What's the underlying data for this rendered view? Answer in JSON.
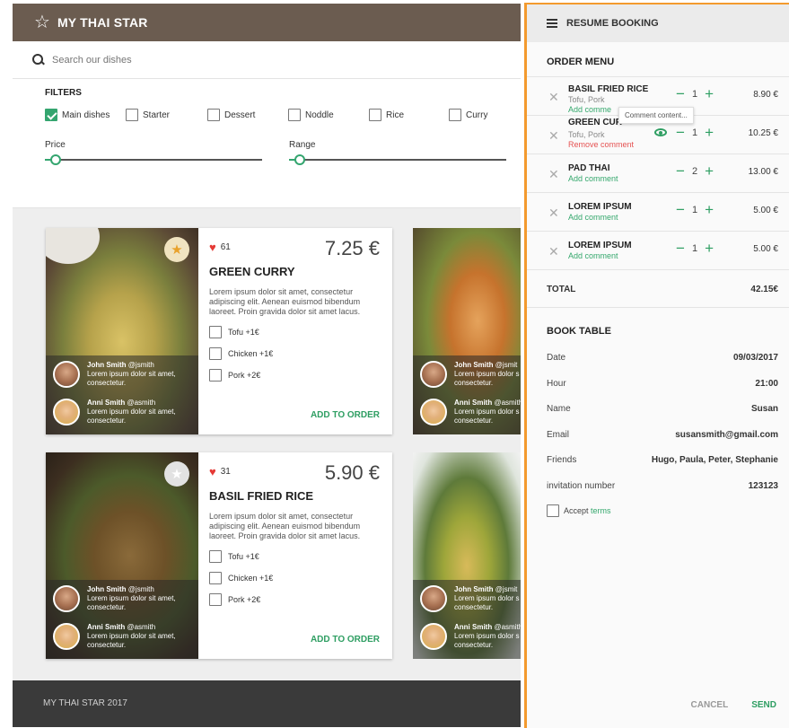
{
  "app": {
    "title": "MY THAI STAR",
    "search_placeholder": "Search our dishes",
    "filters_label": "FILTERS",
    "categories": [
      {
        "label": "Main dishes",
        "checked": true
      },
      {
        "label": "Starter",
        "checked": false
      },
      {
        "label": "Dessert",
        "checked": false
      },
      {
        "label": "Noddle",
        "checked": false
      },
      {
        "label": "Rice",
        "checked": false
      },
      {
        "label": "Curry",
        "checked": false
      }
    ],
    "price_label": "Price",
    "range_label": "Range",
    "footer": "MY THAI STAR 2017"
  },
  "dishes": [
    {
      "name": "GREEN CURRY",
      "likes": "61",
      "price": "7.25 €",
      "favorite": true,
      "description": "Lorem ipsum dolor sit amet, consectetur adipiscing elit. Aenean euismod bibendum laoreet. Proin gravida dolor sit amet lacus.",
      "extras": [
        "Tofu +1€",
        "Chicken +1€",
        "Pork +2€"
      ],
      "add_label": "ADD TO ORDER",
      "reviews": [
        {
          "name": "John Smith",
          "handle": "@jsmith",
          "text": "Lorem ipsum dolor sit amet, consectetur."
        },
        {
          "name": "Anni Smith",
          "handle": "@asmith",
          "text": "Lorem ipsum dolor sit amet, consectetur."
        }
      ]
    },
    {
      "name": "BASIL FRIED RICE",
      "likes": "31",
      "price": "5.90 €",
      "favorite": false,
      "description": "Lorem ipsum dolor sit amet, consectetur adipiscing elit. Aenean euismod bibendum laoreet. Proin gravida dolor sit amet lacus.",
      "extras": [
        "Tofu +1€",
        "Chicken +1€",
        "Pork +2€"
      ],
      "add_label": "ADD TO ORDER",
      "reviews": [
        {
          "name": "John Smith",
          "handle": "@jsmith",
          "text": "Lorem ipsum dolor sit amet, consectetur."
        },
        {
          "name": "Anni Smith",
          "handle": "@asmith",
          "text": "Lorem ipsum dolor sit amet, consectetur."
        }
      ]
    }
  ],
  "peek_reviews": [
    {
      "name": "John Smith",
      "handle": "@jsmit",
      "text": "Lorem ipsum dolor s consectetur."
    },
    {
      "name": "Anni Smith",
      "handle": "@asmith",
      "text": "Lorem ipsum dolor s consectetur."
    }
  ],
  "panel": {
    "title": "RESUME BOOKING",
    "order_title": "ORDER MENU",
    "orders": [
      {
        "name": "BASIL FRIED RICE",
        "extras": "Tofu, Pork",
        "link": "Add comment",
        "link_shown": "Add comme",
        "qty": "1",
        "price": "8.90 €"
      },
      {
        "name": "GREEN CURRY",
        "name_shown": "GREEN CUR",
        "extras": "Tofu, Pork",
        "link": "Remove comment",
        "qty": "1",
        "price": "10.25 €",
        "tooltip": "Comment content..."
      },
      {
        "name": "PAD THAI",
        "link": "Add comment",
        "qty": "2",
        "price": "13.00 €"
      },
      {
        "name": "LOREM IPSUM",
        "link": "Add comment",
        "qty": "1",
        "price": "5.00 €"
      },
      {
        "name": "LOREM IPSUM",
        "link": "Add comment",
        "qty": "1",
        "price": "5.00 €"
      }
    ],
    "total_label": "TOTAL",
    "total_value": "42.15€",
    "book_title": "BOOK TABLE",
    "booking": [
      {
        "key": "Date",
        "value": "09/03/2017"
      },
      {
        "key": "Hour",
        "value": "21:00"
      },
      {
        "key": "Name",
        "value": "Susan"
      },
      {
        "key": "Email",
        "value": "susansmith@gmail.com"
      },
      {
        "key": "Friends",
        "value": "Hugo, Paula, Peter, Stephanie"
      },
      {
        "key": "invitation number",
        "value": "123123"
      }
    ],
    "accept_prefix": "Accept",
    "accept_link": "terms",
    "cancel_label": "CANCEL",
    "send_label": "SEND"
  },
  "colors": {
    "brand_bar": "#6b5c50",
    "accent_green": "#2e9e62",
    "highlight_orange": "#f39a2e",
    "remove_red": "#e55353"
  }
}
